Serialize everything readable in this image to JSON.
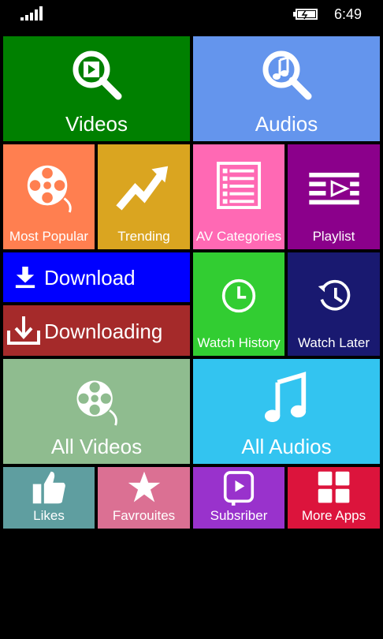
{
  "status": {
    "time": "6:49",
    "signal_icon": "signal-bars-icon",
    "battery_icon": "battery-charging-icon"
  },
  "tiles": {
    "videos": {
      "label": "Videos",
      "color": "#008000",
      "icon": "video-search-icon"
    },
    "audios": {
      "label": "Audios",
      "color": "#6495ED",
      "icon": "music-search-icon"
    },
    "most_popular": {
      "label": "Most Popular",
      "color": "#FF7F50",
      "icon": "film-reel-icon"
    },
    "trending": {
      "label": "Trending",
      "color": "#DAA520",
      "icon": "trending-arrow-icon"
    },
    "av_categories": {
      "label": "AV Categories",
      "color": "#FF69B4",
      "icon": "list-icon"
    },
    "playlist": {
      "label": "Playlist",
      "color": "#8B008B",
      "icon": "playlist-icon"
    },
    "download": {
      "label": "Download",
      "color": "#0000FF",
      "icon": "download-icon"
    },
    "downloading": {
      "label": "Downloading",
      "color": "#A52A2A",
      "icon": "downloading-icon"
    },
    "watch_history": {
      "label": "Watch History",
      "color": "#32CD32",
      "icon": "clock-icon"
    },
    "watch_later": {
      "label": "Watch Later",
      "color": "#191970",
      "icon": "history-clock-icon"
    },
    "all_videos": {
      "label": "All Videos",
      "color": "#8FBC8F",
      "icon": "film-reel-icon"
    },
    "all_audios": {
      "label": "All Audios",
      "color": "#33C4F0",
      "icon": "music-note-icon"
    },
    "likes": {
      "label": "Likes",
      "color": "#5F9EA0",
      "icon": "thumbs-up-icon"
    },
    "favourites": {
      "label": "Favrouites",
      "color": "#DB7093",
      "icon": "star-icon"
    },
    "subscriber": {
      "label": "Subsriber",
      "color": "#9932CC",
      "icon": "subscribe-icon"
    },
    "more_apps": {
      "label": "More Apps",
      "color": "#DC143C",
      "icon": "apps-grid-icon"
    }
  }
}
